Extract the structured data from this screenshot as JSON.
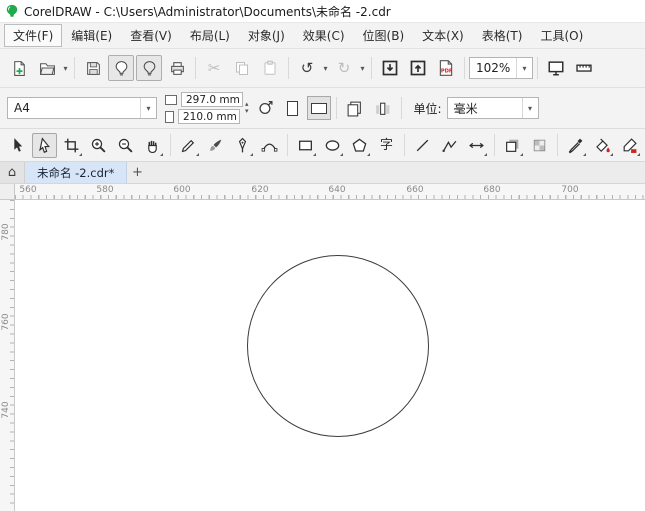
{
  "window": {
    "title": "CorelDRAW - C:\\Users\\Administrator\\Documents\\未命名 -2.cdr"
  },
  "menu": {
    "items": [
      {
        "label": "文件(F)",
        "active": true
      },
      {
        "label": "编辑(E)",
        "active": false
      },
      {
        "label": "查看(V)",
        "active": false
      },
      {
        "label": "布局(L)",
        "active": false
      },
      {
        "label": "对象(J)",
        "active": false
      },
      {
        "label": "效果(C)",
        "active": false
      },
      {
        "label": "位图(B)",
        "active": false
      },
      {
        "label": "文本(X)",
        "active": false
      },
      {
        "label": "表格(T)",
        "active": false
      },
      {
        "label": "工具(O)",
        "active": false
      }
    ]
  },
  "toolbar": {
    "zoom_level": "102%",
    "pdf_label": "PDF",
    "icons": [
      "new-document",
      "open",
      "save",
      "welcome-screen",
      "launcher",
      "print",
      "cut",
      "copy",
      "paste",
      "undo",
      "redo",
      "import",
      "export",
      "publish-pdf",
      "zoom-level",
      "fullscreen-preview",
      "show-rulers"
    ]
  },
  "property_bar": {
    "page_preset": "A4",
    "page_width": "297.0 mm",
    "page_height": "210.0 mm",
    "orientation": "landscape",
    "units_label": "单位:",
    "units_value": "毫米"
  },
  "toolbox": {
    "active_tool": "shape-tool",
    "text_glyph": "字",
    "tools": [
      "pick",
      "shape",
      "crop",
      "zoom-in",
      "zoom-out",
      "pan",
      "freehand",
      "artistic-media",
      "pen",
      "b-spline",
      "rectangle",
      "ellipse",
      "polygon",
      "text",
      "line",
      "polyline",
      "dimension",
      "drop-shadow",
      "transparency",
      "eyedropper",
      "interactive-fill",
      "outline-pen"
    ]
  },
  "document_tabs": {
    "active_tab": "未命名 -2.cdr*",
    "new_tab": "+"
  },
  "rulers": {
    "horizontal": [
      "560",
      "580",
      "600",
      "620",
      "640",
      "660",
      "680",
      "700"
    ],
    "vertical": [
      "780",
      "760",
      "740"
    ]
  },
  "canvas": {
    "shapes": [
      {
        "type": "ellipse",
        "stroke": "#3c3c3c",
        "fill": "none"
      }
    ]
  },
  "icon_glyphs": {
    "home": "⌂",
    "undo": "↺",
    "redo": "↻",
    "cut": "✂",
    "caret": "▾"
  },
  "colors": {
    "logo_green": "#1faa4b",
    "accent_red": "#cc2222",
    "toolbar_bg": "#f3f3f3",
    "active_tab_bg": "#d7e5f6"
  }
}
